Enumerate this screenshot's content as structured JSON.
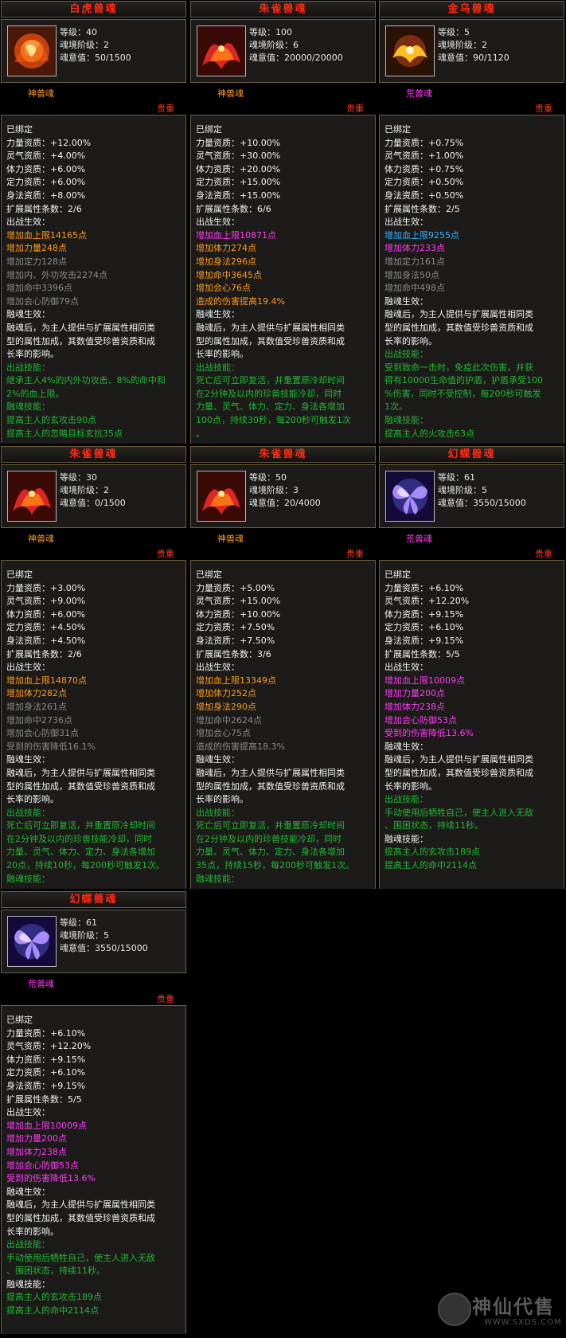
{
  "cards": [
    {
      "title": "白虎兽魂",
      "level": "等级：40",
      "stage": "魂境阶级：2",
      "soul": "魂意值：50/1500",
      "category": "神兽魂",
      "category_color": "#ff9a1e",
      "rarity": "贵重",
      "icon": "white-tiger-icon",
      "lines": [
        {
          "t": "已绑定",
          "c": "wh"
        },
        {
          "t": "力量资质：+12.00%",
          "c": "wh"
        },
        {
          "t": "灵气资质：+4.00%",
          "c": "wh"
        },
        {
          "t": "体力资质：+6.00%",
          "c": "wh"
        },
        {
          "t": "定力资质：+6.00%",
          "c": "wh"
        },
        {
          "t": "身法资质：+8.00%",
          "c": "wh"
        },
        {
          "t": "扩展属性条数：2/6",
          "c": "wh"
        },
        {
          "t": "出战生效：",
          "c": "wh"
        },
        {
          "t": "增加血上限14165点",
          "c": "or"
        },
        {
          "t": "增加力量248点",
          "c": "or"
        },
        {
          "t": "增加定力128点",
          "c": "gr"
        },
        {
          "t": "增加内、外功攻击2274点",
          "c": "gr"
        },
        {
          "t": "增加命中3396点",
          "c": "gr"
        },
        {
          "t": "增加会心防御79点",
          "c": "gr"
        },
        {
          "t": "融魂生效：",
          "c": "wh"
        },
        {
          "t": "融魂后，为主人提供与扩展属性相同类",
          "c": "wh"
        },
        {
          "t": "型的属性加成，其数值受珍兽资质和成",
          "c": "wh"
        },
        {
          "t": "长率的影响。",
          "c": "wh"
        },
        {
          "t": "出战技能：",
          "c": "gn"
        },
        {
          "t": "继承主人4%的内外功攻击、8%的命中和",
          "c": "gn"
        },
        {
          "t": "2%的血上限。",
          "c": "gn"
        },
        {
          "t": "融魂技能：",
          "c": "gn"
        },
        {
          "t": "提高主人的玄攻击90点",
          "c": "gn"
        },
        {
          "t": "提高主人的忽略目标玄抗35点",
          "c": "gn"
        }
      ]
    },
    {
      "title": "朱雀兽魂",
      "level": "等级：100",
      "stage": "魂境阶级：6",
      "soul": "魂意值：20000/20000",
      "category": "神兽魂",
      "category_color": "#ff9a1e",
      "rarity": "贵重",
      "icon": "vermilion-bird-icon",
      "lines": [
        {
          "t": "已绑定",
          "c": "wh"
        },
        {
          "t": "力量资质：+10.00%",
          "c": "wh"
        },
        {
          "t": "灵气资质：+30.00%",
          "c": "wh"
        },
        {
          "t": "体力资质：+20.00%",
          "c": "wh"
        },
        {
          "t": "定力资质：+15.00%",
          "c": "wh"
        },
        {
          "t": "身法资质：+15.00%",
          "c": "wh"
        },
        {
          "t": "扩展属性条数：6/6",
          "c": "wh"
        },
        {
          "t": "出战生效：",
          "c": "wh"
        },
        {
          "t": "增加血上限10871点",
          "c": "pu"
        },
        {
          "t": "增加体力274点",
          "c": "or"
        },
        {
          "t": "增加身法296点",
          "c": "or"
        },
        {
          "t": "增加命中3645点",
          "c": "or"
        },
        {
          "t": "增加会心76点",
          "c": "or"
        },
        {
          "t": "造成的伤害提高19.4%",
          "c": "or"
        },
        {
          "t": "融魂生效：",
          "c": "wh"
        },
        {
          "t": "融魂后，为主人提供与扩展属性相同类",
          "c": "wh"
        },
        {
          "t": "型的属性加成，其数值受珍兽资质和成",
          "c": "wh"
        },
        {
          "t": "长率的影响。",
          "c": "wh"
        },
        {
          "t": "出战技能：",
          "c": "gn"
        },
        {
          "t": "死亡后可立即复活，并重置原冷却时间",
          "c": "gn"
        },
        {
          "t": "在2分钟及以内的珍兽技能冷却，同时",
          "c": "gn"
        },
        {
          "t": "力量、灵气、体力、定力、身法各增加",
          "c": "gn"
        },
        {
          "t": "100点，持续30秒，每200秒可触发1次",
          "c": "gn"
        },
        {
          "t": "。",
          "c": "gn"
        }
      ]
    },
    {
      "title": "金乌兽魂",
      "level": "等级：5",
      "stage": "魂境阶级：2",
      "soul": "魂意值：90/1120",
      "category": "荒兽魂",
      "category_color": "#ff3bf5",
      "rarity": "贵重",
      "icon": "golden-crow-icon",
      "lines": [
        {
          "t": "已绑定",
          "c": "wh"
        },
        {
          "t": "力量资质：+0.75%",
          "c": "wh"
        },
        {
          "t": "灵气资质：+1.00%",
          "c": "wh"
        },
        {
          "t": "体力资质：+0.75%",
          "c": "wh"
        },
        {
          "t": "定力资质：+0.50%",
          "c": "wh"
        },
        {
          "t": "身法资质：+0.50%",
          "c": "wh"
        },
        {
          "t": "扩展属性条数：2/5",
          "c": "wh"
        },
        {
          "t": "出战生效：",
          "c": "wh"
        },
        {
          "t": "增加血上限9255点",
          "c": "bl"
        },
        {
          "t": "增加体力233点",
          "c": "pu"
        },
        {
          "t": "增加定力161点",
          "c": "gr"
        },
        {
          "t": "增加身法50点",
          "c": "gr"
        },
        {
          "t": "增加命中498点",
          "c": "gr"
        },
        {
          "t": "融魂生效：",
          "c": "wh"
        },
        {
          "t": "融魂后，为主人提供与扩展属性相同类",
          "c": "wh"
        },
        {
          "t": "型的属性加成，其数值受珍兽资质和成",
          "c": "wh"
        },
        {
          "t": "长率的影响。",
          "c": "wh"
        },
        {
          "t": "出战技能：",
          "c": "gn"
        },
        {
          "t": "受到致命一击时，免疫此次伤害，并获",
          "c": "gn"
        },
        {
          "t": "得有10000生命值的护盾，护盾承受100",
          "c": "gn"
        },
        {
          "t": "%伤害，同时不受控制，每200秒可触发",
          "c": "gn"
        },
        {
          "t": "1次。",
          "c": "gn"
        },
        {
          "t": "融魂技能：",
          "c": "gn"
        },
        {
          "t": "提高主人的火攻击63点",
          "c": "gn"
        }
      ]
    },
    {
      "title": "朱雀兽魂",
      "level": "等级：30",
      "stage": "魂境阶级：2",
      "soul": "魂意值：0/1500",
      "category": "神兽魂",
      "category_color": "#ff9a1e",
      "rarity": "贵重",
      "icon": "vermilion-bird-icon",
      "lines": [
        {
          "t": "已绑定",
          "c": "wh"
        },
        {
          "t": "力量资质：+3.00%",
          "c": "wh"
        },
        {
          "t": "灵气资质：+9.00%",
          "c": "wh"
        },
        {
          "t": "体力资质：+6.00%",
          "c": "wh"
        },
        {
          "t": "定力资质：+4.50%",
          "c": "wh"
        },
        {
          "t": "身法资质：+4.50%",
          "c": "wh"
        },
        {
          "t": "扩展属性条数：2/6",
          "c": "wh"
        },
        {
          "t": "出战生效：",
          "c": "wh"
        },
        {
          "t": "增加血上限14870点",
          "c": "or"
        },
        {
          "t": "增加体力282点",
          "c": "or"
        },
        {
          "t": "增加身法261点",
          "c": "gr"
        },
        {
          "t": "增加命中2736点",
          "c": "gr"
        },
        {
          "t": "增加会心防御31点",
          "c": "gr"
        },
        {
          "t": "受到的伤害降低16.1%",
          "c": "gr"
        },
        {
          "t": "融魂生效：",
          "c": "wh"
        },
        {
          "t": "融魂后，为主人提供与扩展属性相同类",
          "c": "wh"
        },
        {
          "t": "型的属性加成，其数值受珍兽资质和成",
          "c": "wh"
        },
        {
          "t": "长率的影响。",
          "c": "wh"
        },
        {
          "t": "出战技能：",
          "c": "gn"
        },
        {
          "t": "死亡后可立即复活，并重置原冷却时间",
          "c": "gn"
        },
        {
          "t": "在2分钟及以内的珍兽技能冷却，同时",
          "c": "gn"
        },
        {
          "t": "力量、灵气、体力、定力、身法各增加",
          "c": "gn"
        },
        {
          "t": "20点，持续10秒，每200秒可触发1次。",
          "c": "gn"
        },
        {
          "t": "融魂技能：",
          "c": "gn"
        }
      ]
    },
    {
      "title": "朱雀兽魂",
      "level": "等级：50",
      "stage": "魂境阶级：3",
      "soul": "魂意值：20/4000",
      "category": "神兽魂",
      "category_color": "#ff9a1e",
      "rarity": "贵重",
      "icon": "vermilion-bird-icon",
      "lines": [
        {
          "t": "已绑定",
          "c": "wh"
        },
        {
          "t": "力量资质：+5.00%",
          "c": "wh"
        },
        {
          "t": "灵气资质：+15.00%",
          "c": "wh"
        },
        {
          "t": "体力资质：+10.00%",
          "c": "wh"
        },
        {
          "t": "定力资质：+7.50%",
          "c": "wh"
        },
        {
          "t": "身法资质：+7.50%",
          "c": "wh"
        },
        {
          "t": "扩展属性条数：3/6",
          "c": "wh"
        },
        {
          "t": "出战生效：",
          "c": "wh"
        },
        {
          "t": "增加血上限13349点",
          "c": "or"
        },
        {
          "t": "增加体力252点",
          "c": "or"
        },
        {
          "t": "增加身法290点",
          "c": "or"
        },
        {
          "t": "增加命中2624点",
          "c": "gr"
        },
        {
          "t": "增加会心75点",
          "c": "gr"
        },
        {
          "t": "造成的伤害提高18.3%",
          "c": "gr"
        },
        {
          "t": "融魂生效：",
          "c": "wh"
        },
        {
          "t": "融魂后，为主人提供与扩展属性相同类",
          "c": "wh"
        },
        {
          "t": "型的属性加成，其数值受珍兽资质和成",
          "c": "wh"
        },
        {
          "t": "长率的影响。",
          "c": "wh"
        },
        {
          "t": "出战技能：",
          "c": "gn"
        },
        {
          "t": "死亡后可立即复活，并重置原冷却时间",
          "c": "gn"
        },
        {
          "t": "在2分钟及以内的珍兽技能冷却，同时",
          "c": "gn"
        },
        {
          "t": "力量、灵气、体力、定力、身法各增加",
          "c": "gn"
        },
        {
          "t": "35点，持续15秒，每200秒可触发1次。",
          "c": "gn"
        },
        {
          "t": "融魂技能：",
          "c": "gn"
        }
      ]
    },
    {
      "title": "幻蝶兽魂",
      "level": "等级：61",
      "stage": "魂境阶级：5",
      "soul": "魂意值：3550/15000",
      "category": "荒兽魂",
      "category_color": "#ff3bf5",
      "rarity": "贵重",
      "icon": "phantom-butterfly-icon",
      "lines": [
        {
          "t": "已绑定",
          "c": "wh"
        },
        {
          "t": "力量资质：+6.10%",
          "c": "wh"
        },
        {
          "t": "灵气资质：+12.20%",
          "c": "wh"
        },
        {
          "t": "体力资质：+9.15%",
          "c": "wh"
        },
        {
          "t": "定力资质：+6.10%",
          "c": "wh"
        },
        {
          "t": "身法资质：+9.15%",
          "c": "wh"
        },
        {
          "t": "扩展属性条数：5/5",
          "c": "wh"
        },
        {
          "t": "出战生效：",
          "c": "wh"
        },
        {
          "t": "增加血上限10009点",
          "c": "pu"
        },
        {
          "t": "增加力量200点",
          "c": "pu"
        },
        {
          "t": "增加体力238点",
          "c": "pu"
        },
        {
          "t": "增加会心防御53点",
          "c": "pu"
        },
        {
          "t": "受到的伤害降低13.6%",
          "c": "pu"
        },
        {
          "t": "融魂生效：",
          "c": "wh"
        },
        {
          "t": "融魂后，为主人提供与扩展属性相同类",
          "c": "wh"
        },
        {
          "t": "型的属性加成，其数值受珍兽资质和成",
          "c": "wh"
        },
        {
          "t": "长率的影响。",
          "c": "wh"
        },
        {
          "t": "出战技能：",
          "c": "gn"
        },
        {
          "t": "手动使用后牺牲自己，使主人进入无敌",
          "c": "gn"
        },
        {
          "t": "、围困状态，持续11秒。",
          "c": "gn"
        },
        {
          "t": "融魂技能：",
          "c": "wh"
        },
        {
          "t": "提高主人的玄攻击189点",
          "c": "gn"
        },
        {
          "t": "提高主人的命中2114点",
          "c": "gn"
        }
      ]
    },
    {
      "title": "幻蝶兽魂",
      "level": "等级：61",
      "stage": "魂境阶级：5",
      "soul": "魂意值：3550/15000",
      "category": "荒兽魂",
      "category_color": "#ff3bf5",
      "rarity": "贵重",
      "icon": "phantom-butterfly-icon",
      "lines": [
        {
          "t": "已绑定",
          "c": "wh"
        },
        {
          "t": "力量资质：+6.10%",
          "c": "wh"
        },
        {
          "t": "灵气资质：+12.20%",
          "c": "wh"
        },
        {
          "t": "体力资质：+9.15%",
          "c": "wh"
        },
        {
          "t": "定力资质：+6.10%",
          "c": "wh"
        },
        {
          "t": "身法资质：+9.15%",
          "c": "wh"
        },
        {
          "t": "扩展属性条数：5/5",
          "c": "wh"
        },
        {
          "t": "出战生效：",
          "c": "wh"
        },
        {
          "t": "增加血上限10009点",
          "c": "pu"
        },
        {
          "t": "增加力量200点",
          "c": "pu"
        },
        {
          "t": "增加体力238点",
          "c": "pu"
        },
        {
          "t": "增加会心防御53点",
          "c": "pu"
        },
        {
          "t": "受到的伤害降低13.6%",
          "c": "pu"
        },
        {
          "t": "融魂生效：",
          "c": "wh"
        },
        {
          "t": "融魂后，为主人提供与扩展属性相同类",
          "c": "wh"
        },
        {
          "t": "型的属性加成，其数值受珍兽资质和成",
          "c": "wh"
        },
        {
          "t": "长率的影响。",
          "c": "wh"
        },
        {
          "t": "出战技能：",
          "c": "gn"
        },
        {
          "t": "手动使用后牺牲自己，使主人进入无敌",
          "c": "gn"
        },
        {
          "t": "、围困状态，持续11秒。",
          "c": "gn"
        },
        {
          "t": "融魂技能：",
          "c": "wh"
        },
        {
          "t": "提高主人的玄攻击189点",
          "c": "gn"
        },
        {
          "t": "提高主人的命中2114点",
          "c": "gn"
        }
      ]
    }
  ],
  "watermark": {
    "text": "神仙代售",
    "url": "WWW.SXDS.COM"
  }
}
